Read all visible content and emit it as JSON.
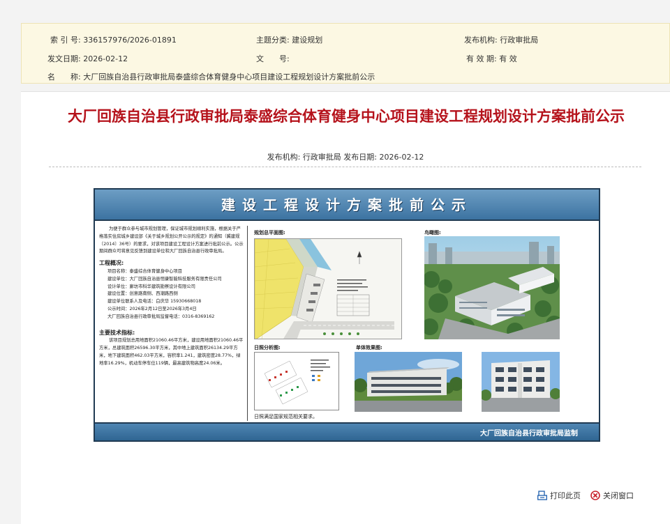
{
  "meta": {
    "index_label": "索 引 号:",
    "index_value": "336157976/2026-01891",
    "topic_label": "主题分类:",
    "topic_value": "建设规划",
    "publisher_label": "发布机构:",
    "publisher_value": "行政审批局",
    "date_label": "发文日期:",
    "date_value": "2026-02-12",
    "docno_label": "文　　号:",
    "docno_value": "",
    "validity_label": "有 效 期:",
    "validity_value": "有 效",
    "name_label": "名　　称:",
    "name_value": "大厂回族自治县行政审批局泰盛综合体育健身中心项目建设工程规划设计方案批前公示"
  },
  "article": {
    "title": "大厂回族自治县行政审批局泰盛综合体育健身中心项目建设工程规划设计方案批前公示",
    "subline": "发布机构: 行政审批局 发布日期: 2026-02-12"
  },
  "poster": {
    "header": "建设工程设计方案批前公示",
    "intro": "为便于群众参与城市规划管理，保证城市规划顺利实施，根据关于严格落实住房城乡建设部《关于城乡规划公开公示的规定》的通知（冀建规〔2014〕36号）的要求，对该项目建设工程设计方案进行批前公示。公示期间群众可将意见反馈到建设单位和大厂回族自治县行政审批局。",
    "overview_title": "工程概况:",
    "overview": [
      "项目名称：泰盛综合体育健身中心项目",
      "建设单位：大厂回族自治县恒康智能科技服务有限责任公司",
      "设计单位：廊坊市科华建筑勘察设计有限公司",
      "建设位置：创意路南侧、西潮路西侧",
      "建设单位联系人及电话：白庆华  15930668018",
      "公示时间：2026年2月12日至2026年3月4日",
      "大厂回族自治县行政审批局监督电话：0316-8369162"
    ],
    "tech_title": "主要技术指标:",
    "tech": "该项目规划总用地面积21060.46平方米，建设用地面积21060.46平方米，总建筑面积26596.30平方米，其中地上建筑面积26134.29平方米，地下建筑面积462.03平方米，容积率1.241，建筑密度28.77%，绿地率16.29%，机动车停车位119辆，最高建筑物高度24.06米。",
    "site_plan_label": "规划总平面图:",
    "aerial_label": "鸟瞰图:",
    "sun_label": "日照分析图:",
    "effect_label": "单体效果图:",
    "sun_note": "日照满足国家规范相关要求。",
    "footer": "大厂回族自治县行政审批局监制"
  },
  "actions": {
    "print": "打印此页",
    "close": "关闭窗口"
  },
  "colors": {
    "title_red": "#b5121b",
    "meta_bg": "#fcf8e3",
    "poster_blue": "#3c73a1"
  },
  "icons": {
    "print": "print-icon",
    "close": "close-circle-icon"
  }
}
